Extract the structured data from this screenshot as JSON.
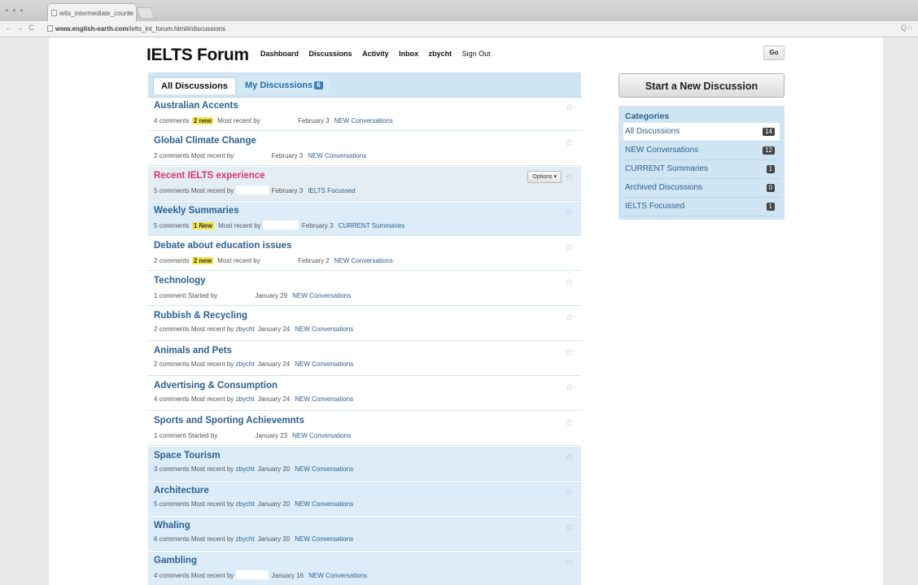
{
  "browser": {
    "tab_title": "ielts_intermediate_course",
    "tab_close": "×",
    "url_host": "www.english-earth.com",
    "url_path": "/ielts_int_forum.html#/discussions",
    "back": "←",
    "forward": "→",
    "reload": "C",
    "right_icons": "Q☆"
  },
  "site": {
    "logo": "IELTS Forum",
    "nav": [
      "Dashboard",
      "Discussions",
      "Activity",
      "Inbox",
      "zbycht",
      "Sign Out"
    ],
    "go_label": "Go"
  },
  "tabs": {
    "all_label": "All Discussions",
    "mine_label": "My Discussions",
    "mine_count": "6"
  },
  "discussions": [
    {
      "title": "Australian Accents",
      "comments": "4 comments",
      "new": "2 new",
      "by": "Most recent by",
      "user": "",
      "date": "February 3",
      "category": "NEW Conversations"
    },
    {
      "title": "Global Climate Change",
      "comments": "2 comments",
      "new": "",
      "by": "Most recent by",
      "user": "",
      "date": "February 3",
      "category": "NEW Conversations"
    },
    {
      "title": "Recent IELTS experience",
      "comments": "5 comments",
      "new": "",
      "by": "Most recent by",
      "user": "",
      "date": "February 3",
      "category": "IELTS Focussed",
      "options": "Options ▾"
    },
    {
      "title": "Weekly Summaries",
      "comments": "5 comments",
      "new": "1 New",
      "by": "Most recent by",
      "user": "",
      "date": "February 3",
      "category": "CURRENT Summaries"
    },
    {
      "title": "Debate about education issues",
      "comments": "2 comments",
      "new": "2 new",
      "by": "Most recent by",
      "user": "",
      "date": "February 2",
      "category": "NEW Conversations"
    },
    {
      "title": "Technology",
      "comments": "1 comment",
      "new": "",
      "by": "Started by",
      "user": "",
      "date": "January 29",
      "category": "NEW Conversations"
    },
    {
      "title": "Rubbish & Recycling",
      "comments": "2 comments",
      "new": "",
      "by": "Most recent by",
      "user": "zbycht",
      "date": "January 24",
      "category": "NEW Conversations"
    },
    {
      "title": "Animals and Pets",
      "comments": "2 comments",
      "new": "",
      "by": "Most recent by",
      "user": "zbycht",
      "date": "January 24",
      "category": "NEW Conversations"
    },
    {
      "title": "Advertising & Consumption",
      "comments": "4 comments",
      "new": "",
      "by": "Most recent by",
      "user": "zbycht",
      "date": "January 24",
      "category": "NEW Conversations"
    },
    {
      "title": "Sports and Sporting Achievemnts",
      "comments": "1 comment",
      "new": "",
      "by": "Started by",
      "user": "",
      "date": "January 23",
      "category": "NEW Conversations"
    },
    {
      "title": "Space Tourism",
      "comments": "3 comments",
      "new": "",
      "by": "Most recent by",
      "user": "zbycht",
      "date": "January 20",
      "category": "NEW Conversations"
    },
    {
      "title": "Architecture",
      "comments": "5 comments",
      "new": "",
      "by": "Most recent by",
      "user": "zbycht",
      "date": "January 20",
      "category": "NEW Conversations"
    },
    {
      "title": "Whaling",
      "comments": "6 comments",
      "new": "",
      "by": "Most recent by",
      "user": "zbycht",
      "date": "January 20",
      "category": "NEW Conversations"
    },
    {
      "title": "Gambling",
      "comments": "4 comments",
      "new": "",
      "by": "Most recent by",
      "user": "",
      "date": "January 16",
      "category": "NEW Conversations"
    }
  ],
  "sidebar": {
    "start_button": "Start a New Discussion",
    "categories_heading": "Categories",
    "categories": [
      {
        "label": "All Discussions",
        "count": "14"
      },
      {
        "label": "NEW Conversations",
        "count": "12"
      },
      {
        "label": "CURRENT Summaries",
        "count": "1"
      },
      {
        "label": "Archived Discussions",
        "count": "0"
      },
      {
        "label": "IELTS Focussed",
        "count": "1"
      }
    ]
  },
  "colors": {
    "accent": "#2d5f8f",
    "hot_title": "#e0346d",
    "new_badge": "#f3e84a",
    "row_alt": "#dcedf9"
  }
}
